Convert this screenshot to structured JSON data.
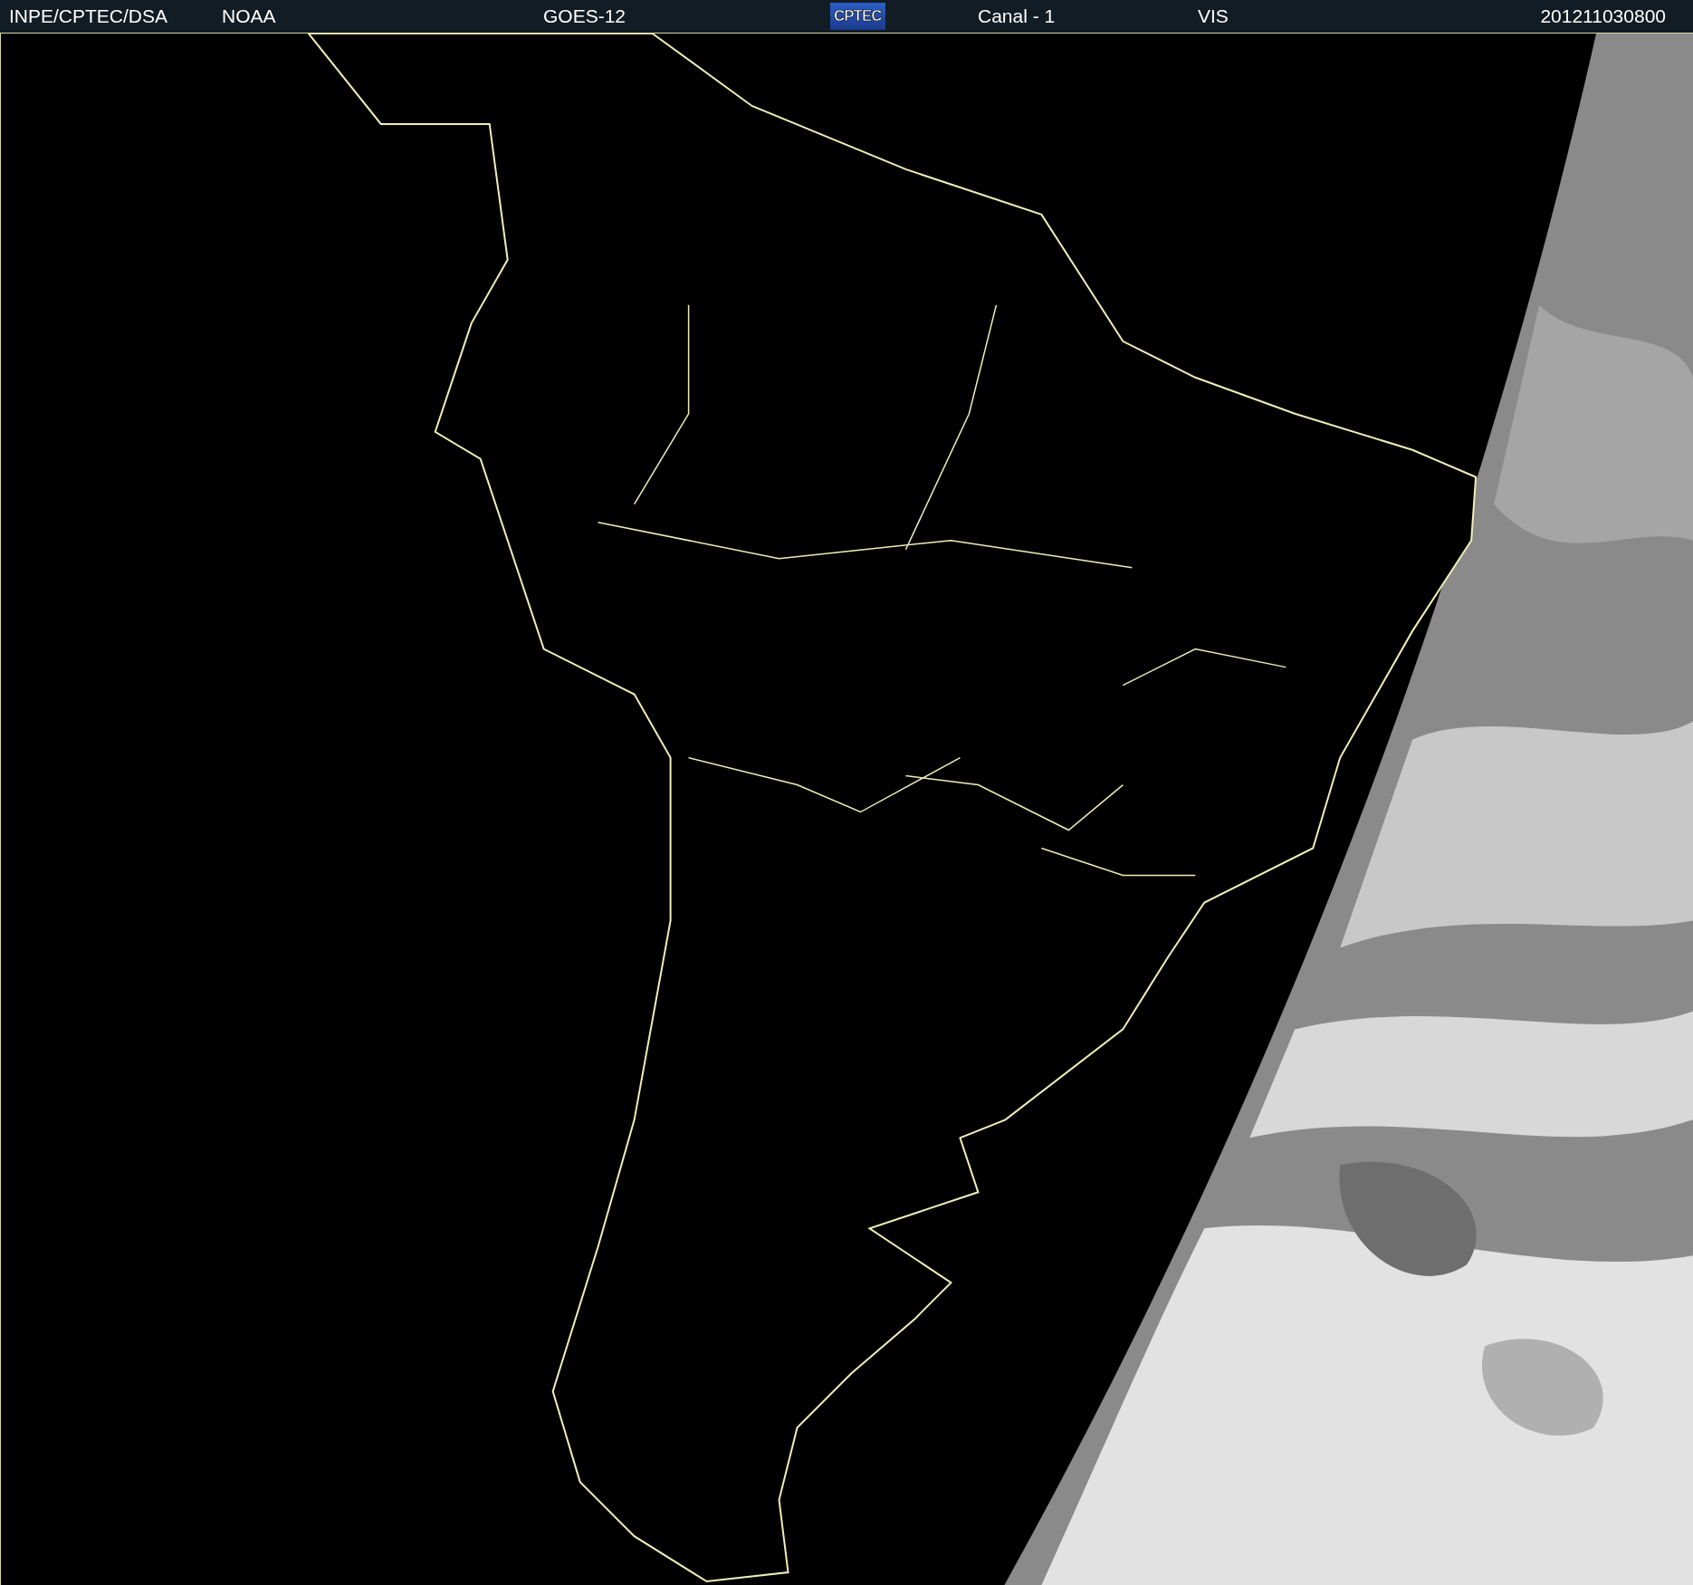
{
  "header": {
    "items": [
      {
        "kind": "text",
        "text": "INPE/CPTEC/DSA"
      },
      {
        "kind": "text",
        "text": "NOAA"
      },
      {
        "kind": "text",
        "text": "GOES-12"
      },
      {
        "kind": "logo",
        "text": "CPTEC"
      },
      {
        "kind": "text",
        "text": "Canal - 1"
      },
      {
        "kind": "text",
        "text": "VIS"
      },
      {
        "kind": "text",
        "text": "201211030800"
      }
    ]
  }
}
